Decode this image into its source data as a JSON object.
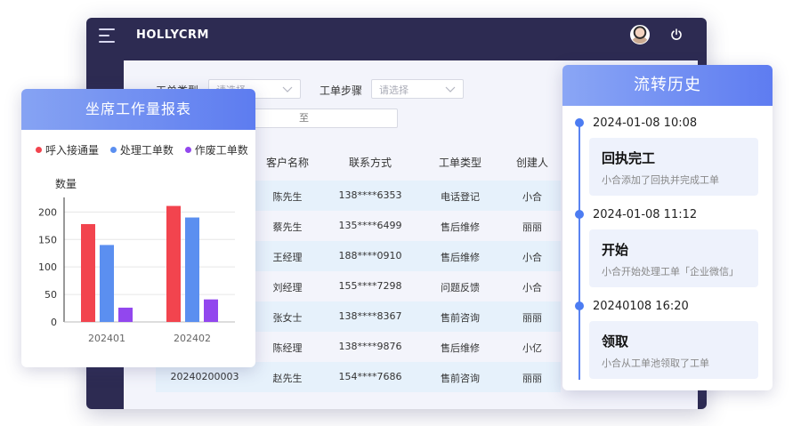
{
  "header": {
    "brand": "HOLLYCRM",
    "icons": {
      "menu": "menu-icon",
      "avatar": "avatar",
      "power": "power-icon"
    }
  },
  "filters": {
    "ticket_type_label": "工单类型",
    "ticket_type_placeholder": "请选择",
    "ticket_step_label": "工单步骤",
    "ticket_step_placeholder": "请选择",
    "range_separator": "至"
  },
  "table": {
    "headers": [
      "客户名称",
      "联系方式",
      "工单类型",
      "创建人"
    ],
    "rows": [
      {
        "id": "",
        "customer": "陈先生",
        "phone": "138****6353",
        "type": "电话登记",
        "creator": "小合"
      },
      {
        "id": "",
        "customer": "蔡先生",
        "phone": "135****6499",
        "type": "售后维修",
        "creator": "丽丽"
      },
      {
        "id": "",
        "customer": "王经理",
        "phone": "188****0910",
        "type": "售后维修",
        "creator": "小合"
      },
      {
        "id": "",
        "customer": "刘经理",
        "phone": "155****7298",
        "type": "问题反馈",
        "creator": "小合"
      },
      {
        "id": "",
        "customer": "张女士",
        "phone": "138****8367",
        "type": "售前咨询",
        "creator": "丽丽"
      },
      {
        "id": "",
        "customer": "陈经理",
        "phone": "138****9876",
        "type": "售后维修",
        "creator": "小亿"
      },
      {
        "id": "20240200003",
        "customer": "赵先生",
        "phone": "154****7686",
        "type": "售前咨询",
        "creator": "丽丽"
      }
    ]
  },
  "report": {
    "title": "坐席工作量报表",
    "legend": [
      {
        "label": "呼入接通量",
        "color": "#f2444e"
      },
      {
        "label": "处理工单数",
        "color": "#5b8ff0"
      },
      {
        "label": "作废工单数",
        "color": "#9247ee"
      }
    ]
  },
  "chart_data": {
    "type": "bar",
    "categories": [
      "202401",
      "202402"
    ],
    "series": [
      {
        "name": "呼入接通量",
        "values": [
          178,
          211
        ]
      },
      {
        "name": "处理工单数",
        "values": [
          140,
          190
        ]
      },
      {
        "name": "作废工单数",
        "values": [
          26,
          41
        ]
      }
    ],
    "ylabel": "数量",
    "yticks": [
      0,
      50,
      100,
      150,
      200
    ],
    "ylim": [
      0,
      220
    ],
    "grid": true,
    "legend_position": "top"
  },
  "history": {
    "title": "流转历史",
    "entries": [
      {
        "time": "2024-01-08  10:08",
        "title": "回执完工",
        "desc": "小合添加了回执并完成工单"
      },
      {
        "time": "2024-01-08  11:12",
        "title": "开始",
        "desc": "小合开始处理工单「企业微信」"
      },
      {
        "time": "20240108  16:20",
        "title": "领取",
        "desc": "小合从工单池领取了工单"
      }
    ]
  }
}
